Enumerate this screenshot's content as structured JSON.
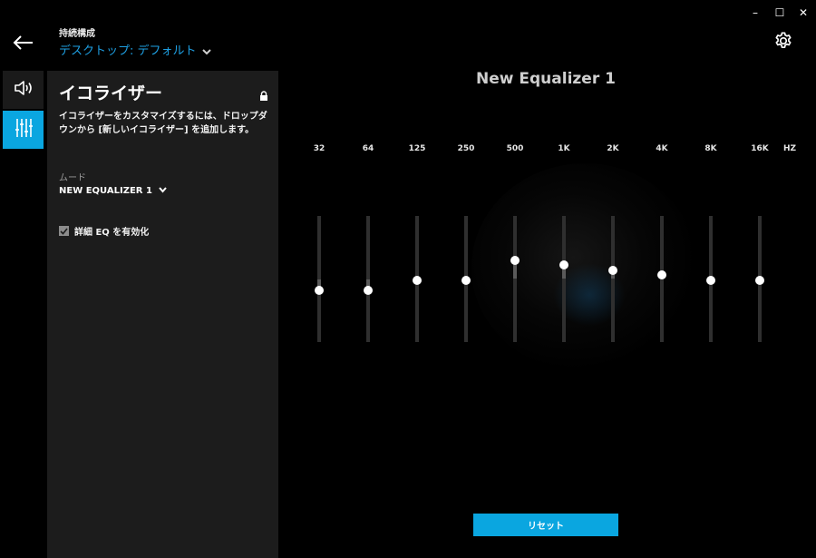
{
  "window_controls": {
    "minimize": "–",
    "maximize": "☐",
    "close": "✕"
  },
  "header": {
    "profile_label": "持続構成",
    "profile_value": "デスクトップ: デフォルト",
    "back_icon": "back-arrow-icon",
    "settings_icon": "gear-icon"
  },
  "rail": [
    {
      "icon": "speaker-icon",
      "active": false
    },
    {
      "icon": "equalizer-sliders-icon",
      "active": true
    }
  ],
  "panel": {
    "title": "イコライザー",
    "description": "イコライザーをカスタマイズするには、ドロップダウンから [新しいイコライザー] を追加します。",
    "mode_label": "ムード",
    "mode_value": "NEW EQUALIZER 1",
    "advanced_eq_label": "詳細 EQ を有効化",
    "advanced_eq_checked": true
  },
  "equalizer": {
    "title": "New Equalizer 1",
    "unit": "HZ",
    "bands": [
      {
        "freq": "32",
        "level": -0.18
      },
      {
        "freq": "64",
        "level": -0.18
      },
      {
        "freq": "125",
        "level": -0.02
      },
      {
        "freq": "250",
        "level": -0.02
      },
      {
        "freq": "500",
        "level": 0.3
      },
      {
        "freq": "1K",
        "level": 0.22
      },
      {
        "freq": "2K",
        "level": 0.14
      },
      {
        "freq": "4K",
        "level": 0.06
      },
      {
        "freq": "8K",
        "level": -0.02
      },
      {
        "freq": "16K",
        "level": -0.02
      }
    ]
  },
  "reset_label": "リセット",
  "colors": {
    "accent": "#0aa6e0",
    "panel_bg": "#1c1c1c",
    "link": "#1e9fe2"
  }
}
